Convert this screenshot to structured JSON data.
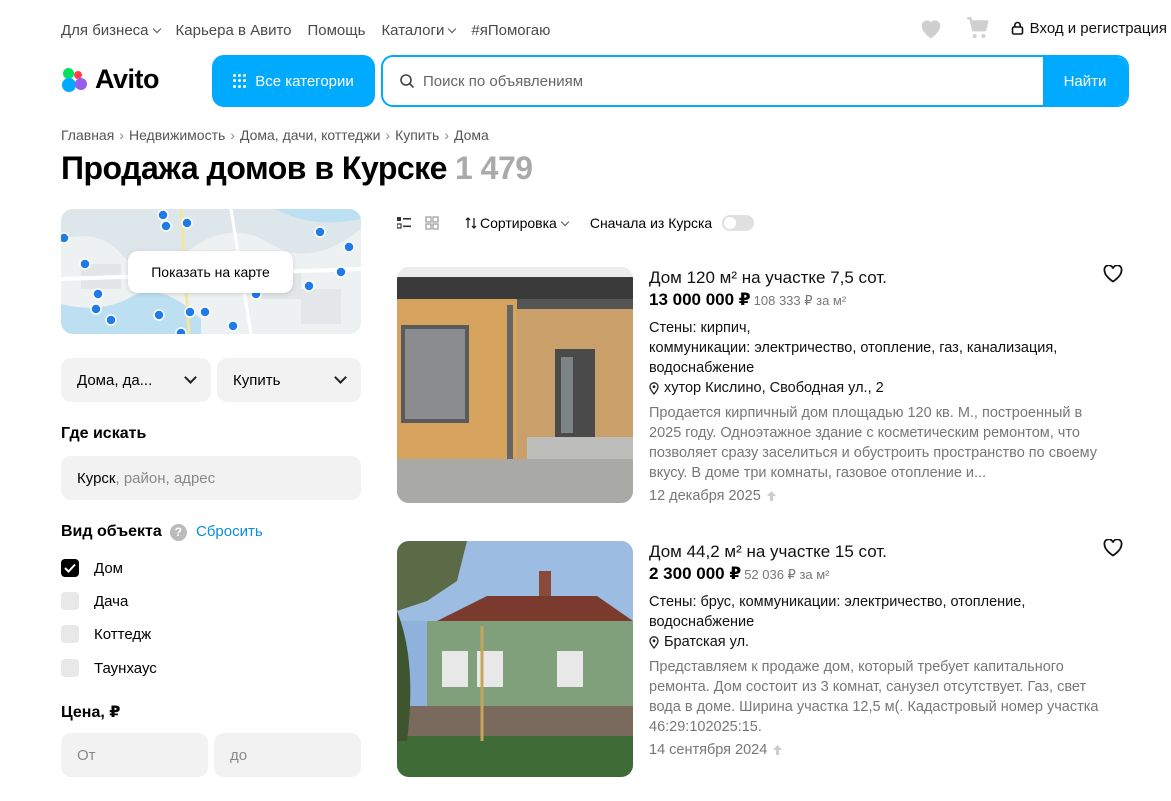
{
  "topnav": {
    "items": [
      {
        "label": "Для бизнеса",
        "dropdown": true
      },
      {
        "label": "Карьера в Авито",
        "dropdown": false
      },
      {
        "label": "Помощь",
        "dropdown": false
      },
      {
        "label": "Каталоги",
        "dropdown": true
      },
      {
        "label": "#яПомогаю",
        "dropdown": false
      }
    ],
    "login_label": "Вход и регистрация"
  },
  "header": {
    "logo_text": "Avito",
    "categories_label": "Все категории",
    "search_placeholder": "Поиск по объявлениям",
    "search_button": "Найти"
  },
  "breadcrumb": [
    "Главная",
    "Недвижимость",
    "Дома, дачи, коттеджи",
    "Купить",
    "Дома"
  ],
  "page": {
    "title": "Продажа домов в Курске",
    "count": "1 479"
  },
  "filters": {
    "map_button": "Показать на карте",
    "type_select": "Дома, да...",
    "deal_select": "Купить",
    "where_label": "Где искать",
    "where_city": "Курск",
    "where_placeholder": ", район, адрес",
    "object_type_label": "Вид объекта",
    "help_mark": "?",
    "reset_label": "Сбросить",
    "object_types": [
      {
        "label": "Дом",
        "checked": true
      },
      {
        "label": "Дача",
        "checked": false
      },
      {
        "label": "Коттедж",
        "checked": false
      },
      {
        "label": "Таунхаус",
        "checked": false
      }
    ],
    "price_label": "Цена, ₽",
    "price_from": "От",
    "price_to": "до"
  },
  "toolbar": {
    "sort_label": "Сортировка",
    "local_first_label": "Сначала из Курска",
    "local_first_on": false
  },
  "listings": [
    {
      "title": "Дом 120 м² на участке 7,5 сот.",
      "price": "13 000 000 ₽",
      "price_per_m2": "108 333 ₽ за м²",
      "params": "Стены: кирпич,\nкоммуникации: электричество, отопление, газ, канализация, водоснабжение",
      "address": "хутор Кислино, Свободная ул., 2",
      "description": "Продается кирпичный дом площадью 120 кв. М., построенный в 2025 году. Одноэтажное здание с косметическим ремонтом, что позволяет сразу заселиться и обустроить пространство по своему вкусу. В доме три комнаты, газовое отопление и...",
      "date": "12 декабря 2025"
    },
    {
      "title": "Дом 44,2 м² на участке 15 сот.",
      "price": "2 300 000 ₽",
      "price_per_m2": "52 036 ₽ за м²",
      "params": "Стены: брус, коммуникации: электричество, отопление, водоснабжение",
      "address": "Братская ул.",
      "description": "Представляем к продаже дом, который требует капитального ремонта. Дом состоит из 3 комнат, санузел отсутствует. Газ, свет вода в доме. Ширина участка 12,5 м(. Кадастровый номер участка 46:29:102025:15.",
      "date": "14 сентября 2024"
    }
  ],
  "colors": {
    "accent": "#00aaff",
    "link": "#0a8ce0",
    "muted": "#777777",
    "logo_green": "#04e061",
    "logo_red": "#ff4053",
    "logo_purple": "#965eeb",
    "logo_blue": "#0af"
  }
}
